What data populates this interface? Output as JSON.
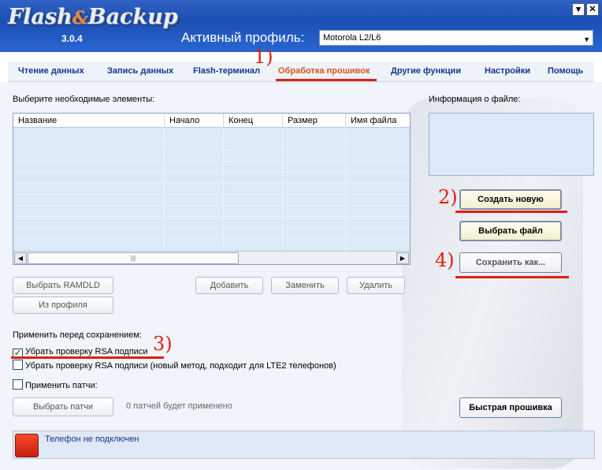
{
  "header": {
    "logo_text_1": "Flash",
    "logo_amp": "&",
    "logo_text_2": "Backup",
    "version": "3.0.4",
    "profile_label": "Активный профиль:",
    "profile_value": "Motorola L2/L6"
  },
  "nav": {
    "tabs": [
      {
        "label": "Чтение данных"
      },
      {
        "label": "Запись данных"
      },
      {
        "label": "Flash-терминал"
      },
      {
        "label": "Обработка прошивок"
      },
      {
        "label": "Другие функции"
      },
      {
        "label": "Настройки"
      },
      {
        "label": "Помощь"
      }
    ],
    "active_tab": "Обработка прошивок"
  },
  "main": {
    "select_label": "Выберите необходимые элементы:",
    "table_columns": [
      "Название",
      "Начало",
      "Конец",
      "Размер",
      "Имя файла"
    ],
    "file_info_label": "Информация о файле:",
    "buttons": {
      "select_ramdld": "Выбрать RAMDLD",
      "from_profile": "Из профиля",
      "add": "Добавить",
      "replace": "Заменить",
      "delete": "Удалить",
      "create_new": "Создать новую",
      "select_file": "Выбрать файл",
      "save_as": "Сохранить как...",
      "select_patches": "Выбрать патчи",
      "fast_flash": "Быстрая прошивка"
    },
    "apply_label": "Применить перед сохранением:",
    "checkboxes": [
      {
        "label": "Убрать проверку RSA подписи",
        "checked": true
      },
      {
        "label": "Убрать проверку RSA подписи (новый метод, подходит для LTE2 телефонов)",
        "checked": false
      },
      {
        "label": "Применить патчи:",
        "checked": false
      }
    ],
    "patches_count_text": "0 патчей будет применено"
  },
  "status": {
    "text": "Телефон не подключен",
    "led_color": "#e0311a"
  },
  "annotations": [
    "1)",
    "2)",
    "3)",
    "4)"
  ],
  "colors": {
    "header_blue": "#1b4fb3",
    "tab_blue": "#16348a",
    "tab_active": "#e0511b",
    "annotation_red": "#e0200f"
  }
}
